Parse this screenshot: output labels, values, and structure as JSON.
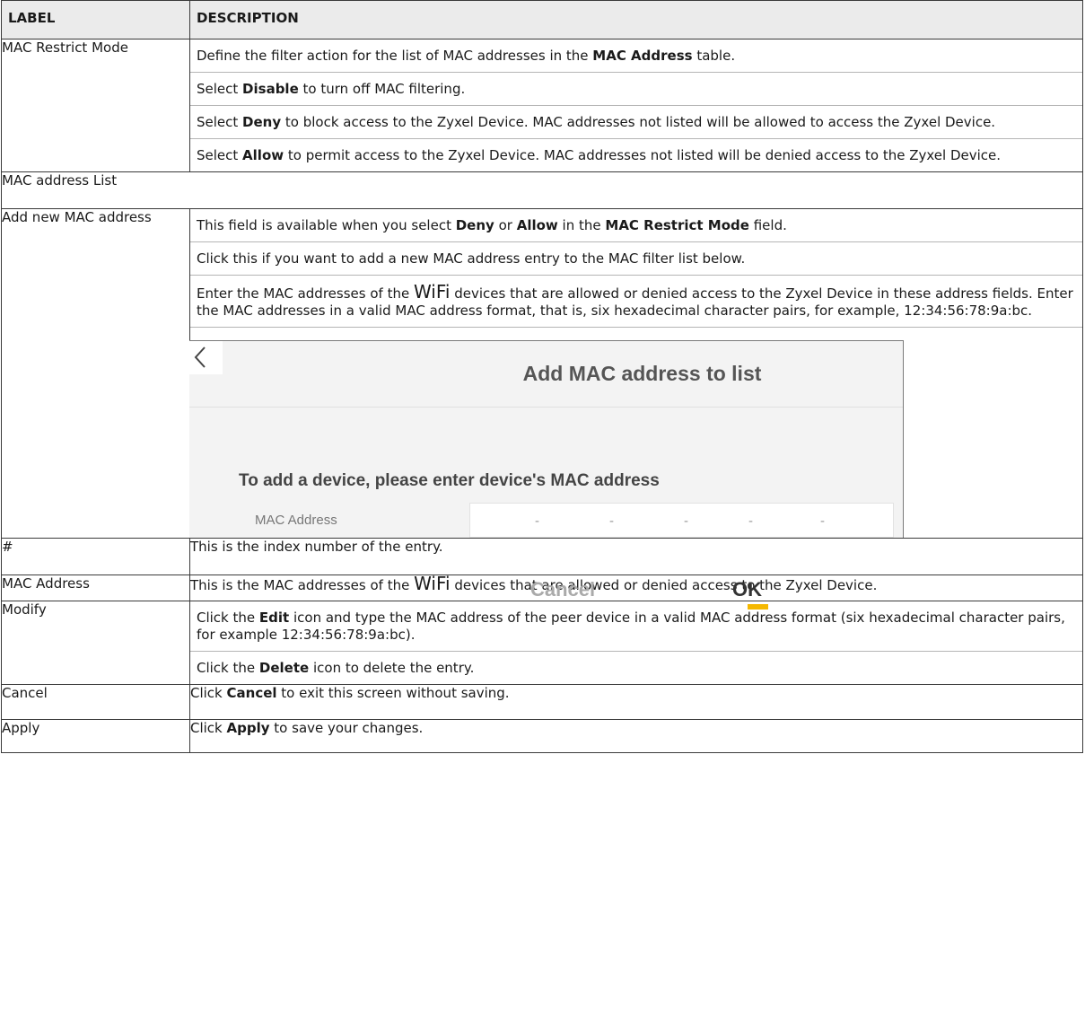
{
  "headers": {
    "label": "LABEL",
    "description": "DESCRIPTION"
  },
  "rows": {
    "mac_restrict": {
      "label": "MAC Restrict Mode",
      "p1": {
        "a": "Define the filter action for the list of MAC addresses in the ",
        "b": "MAC Address",
        "c": " table."
      },
      "p2": {
        "a": "Select ",
        "b": "Disable",
        "c": " to turn off MAC filtering."
      },
      "p3": {
        "a": "Select ",
        "b": "Deny",
        "c": " to block access to the Zyxel Device. MAC addresses not listed will be allowed to access the Zyxel Device."
      },
      "p4": {
        "a": "Select ",
        "b": "Allow",
        "c": " to permit access to the Zyxel Device. MAC addresses not listed will be denied access to the Zyxel Device."
      }
    },
    "mac_list_header": "MAC address List",
    "add_new": {
      "label": "Add new MAC address",
      "p1": {
        "a": "This field is available when you select ",
        "b": "Deny",
        "c": " or ",
        "d": "Allow",
        "e": " in the ",
        "f": "MAC Restrict Mode",
        "g": " field."
      },
      "p2": "Click this if you want to add a new MAC address entry to the MAC filter list below.",
      "p3": {
        "a": "Enter the MAC addresses of the ",
        "wifi": "WiFi",
        "b": " devices that are allowed or denied access to the Zyxel Device in these address fields. Enter the MAC addresses in a valid MAC address format, that is, six hexadecimal character pairs, for example, 12:34:56:78:9a:bc."
      },
      "dialog": {
        "title": "Add MAC address to list",
        "prompt": "To add a device, please enter device's MAC address",
        "field_label": "MAC Address",
        "separators": [
          "-",
          "-",
          "-",
          "-",
          "-"
        ],
        "cancel": "Cancel",
        "ok": "OK",
        "accent_color": "#f5b800",
        "back_icon": "chevron-left-icon"
      }
    },
    "index": {
      "label": "#",
      "desc": "This is the index number of the entry."
    },
    "mac_address": {
      "label": "MAC Address",
      "a": "This is the MAC addresses of the ",
      "wifi": "WiFi",
      "b": " devices that are allowed or denied access to the Zyxel Device."
    },
    "modify": {
      "label": "Modify",
      "p1": {
        "a": "Click the ",
        "b": "Edit",
        "c": " icon and type the MAC address of the peer device in a valid MAC address format (six hexadecimal character pairs, for example 12:34:56:78:9a:bc)."
      },
      "p2": {
        "a": "Click the ",
        "b": "Delete",
        "c": " icon to delete the entry."
      }
    },
    "cancel": {
      "label": "Cancel",
      "a": "Click ",
      "b": "Cancel",
      "c": " to exit this screen without saving."
    },
    "apply": {
      "label": "Apply",
      "a": "Click ",
      "b": "Apply",
      "c": " to save your changes."
    }
  }
}
